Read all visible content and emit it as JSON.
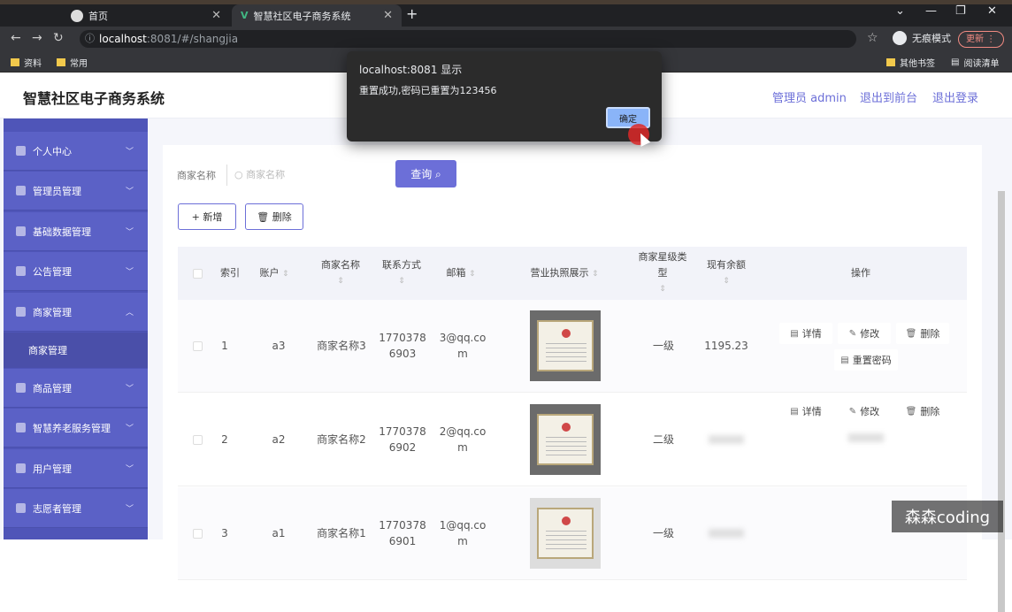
{
  "browser": {
    "tabs": [
      {
        "label": "首页"
      },
      {
        "label": "智慧社区电子商务系统"
      }
    ],
    "url_host": "localhost",
    "url_port_path": ":8081/#/shangjia",
    "incognito_label": "无痕模式",
    "update_label": "更新",
    "bookmarks": [
      "资料",
      "常用"
    ],
    "bookmarks_right": [
      "其他书签",
      "阅读清单"
    ]
  },
  "header": {
    "title": "智慧社区电子商务系统",
    "admin_label": "管理员 admin",
    "front_label": "退出到前台",
    "logout_label": "退出登录"
  },
  "sidebar": {
    "items": [
      {
        "label": "个人中心",
        "chevron": "﹀"
      },
      {
        "label": "管理员管理",
        "chevron": "﹀"
      },
      {
        "label": "基础数据管理",
        "chevron": "﹀"
      },
      {
        "label": "公告管理",
        "chevron": "﹀"
      },
      {
        "label": "商家管理",
        "chevron": "︿"
      },
      {
        "label": "商家管理"
      },
      {
        "label": "商品管理",
        "chevron": "﹀"
      },
      {
        "label": "智慧养老服务管理",
        "chevron": "﹀"
      },
      {
        "label": "用户管理",
        "chevron": "﹀"
      },
      {
        "label": "志愿者管理",
        "chevron": "﹀"
      }
    ]
  },
  "search": {
    "label": "商家名称",
    "placeholder": "商家名称",
    "button": "查询 ⌕"
  },
  "toolbar": {
    "add_label": "+ 新增",
    "delete_label": "🗑 删除"
  },
  "table": {
    "headers": [
      "索引",
      "账户",
      "商家名称",
      "联系方式",
      "邮箱",
      "营业执照展示",
      "商家星级类型",
      "现有余额",
      "操作"
    ],
    "rows": [
      {
        "index": "1",
        "account": "a3",
        "name": "商家名称3",
        "phone": "17703786903",
        "email": "3@qq.com",
        "star": "一级",
        "balance": "1195.23"
      },
      {
        "index": "2",
        "account": "a2",
        "name": "商家名称2",
        "phone": "17703786902",
        "email": "2@qq.com",
        "star": "二级",
        "balance": ""
      },
      {
        "index": "3",
        "account": "a1",
        "name": "商家名称1",
        "phone": "17703786901",
        "email": "1@qq.com",
        "star": "一级",
        "balance": ""
      }
    ],
    "ops": {
      "detail": "详情",
      "edit": "修改",
      "delete": "删除",
      "reset": "重置密码"
    }
  },
  "dialog": {
    "title": "localhost:8081 显示",
    "message": "重置成功,密码已重置为123456",
    "ok": "确定"
  },
  "watermark": "森森coding"
}
